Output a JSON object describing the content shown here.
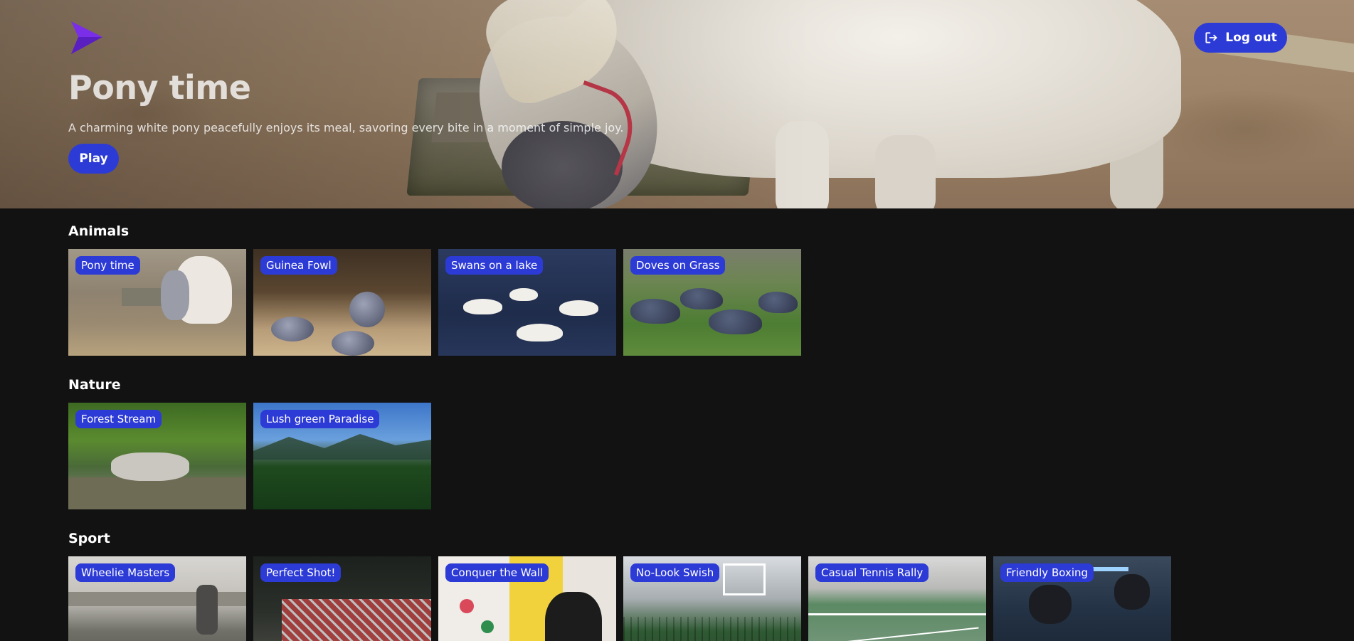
{
  "hero": {
    "title": "Pony time",
    "description": "A charming white pony peacefully enjoys its meal, savoring every bite in a moment of simple joy.",
    "play_label": "Play"
  },
  "header": {
    "logout_label": "Log out",
    "logo_icon": "chevron-logo",
    "logo_color": "#7a2ee8"
  },
  "colors": {
    "accent": "#2d3bd6",
    "background": "#121212"
  },
  "sections": [
    {
      "title": "Animals",
      "items": [
        {
          "label": "Pony time"
        },
        {
          "label": "Guinea Fowl"
        },
        {
          "label": "Swans on a lake"
        },
        {
          "label": "Doves on Grass"
        }
      ]
    },
    {
      "title": "Nature",
      "items": [
        {
          "label": "Forest Stream"
        },
        {
          "label": "Lush green Paradise"
        }
      ]
    },
    {
      "title": "Sport",
      "items": [
        {
          "label": "Wheelie Masters"
        },
        {
          "label": "Perfect Shot!"
        },
        {
          "label": "Conquer the Wall"
        },
        {
          "label": "No-Look Swish"
        },
        {
          "label": "Casual Tennis Rally"
        },
        {
          "label": "Friendly Boxing"
        }
      ]
    }
  ]
}
